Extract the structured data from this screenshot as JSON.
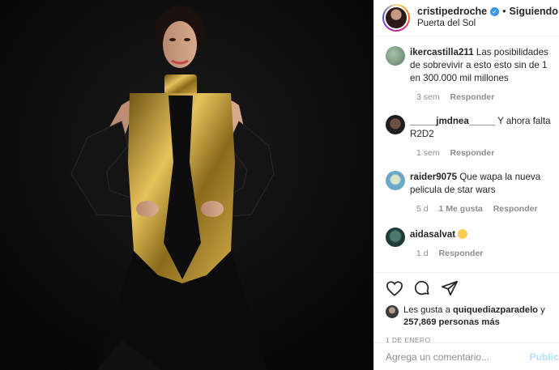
{
  "post": {
    "username": "cristipedroche",
    "dot": "•",
    "follow_label": "Siguiendo",
    "location": "Puerta del Sol",
    "verified_icon": "verified-badge-icon"
  },
  "comments": [
    {
      "user": "ikercastilla211",
      "text": "Las posibilidades de sobrevivir a esto esto sin de 1 en 300.000 mil millones",
      "time": "3 sem",
      "likes": "",
      "reply": "Responder"
    },
    {
      "user": "_____jmdnea_____",
      "text": "Y ahora falta R2D2",
      "time": "1 sem",
      "likes": "",
      "reply": "Responder"
    },
    {
      "user": "raider9075",
      "text": "Que wapa la nueva pelicula de star wars",
      "time": "5 d",
      "likes": "1 Me gusta",
      "reply": "Responder"
    },
    {
      "user": "aidasalvat",
      "text": "",
      "emoji": "grinning-sweat-emoji",
      "time": "1 d",
      "likes": "",
      "reply": "Responder"
    }
  ],
  "actions": {
    "icons": [
      "heart-icon",
      "comment-icon",
      "share-icon"
    ]
  },
  "likes": {
    "prefix": "Les gusta a",
    "user": "quiquediazparadelo",
    "conj": "y",
    "count": "257,869 personas más"
  },
  "date": "1 DE ENERO",
  "composer": {
    "placeholder": "Agrega un comentario...",
    "publish": "Publicar"
  },
  "colors": {
    "link_blue": "#3897f0",
    "meta_gray": "#8e8e8e",
    "publish_disabled": "#b2dffc"
  }
}
